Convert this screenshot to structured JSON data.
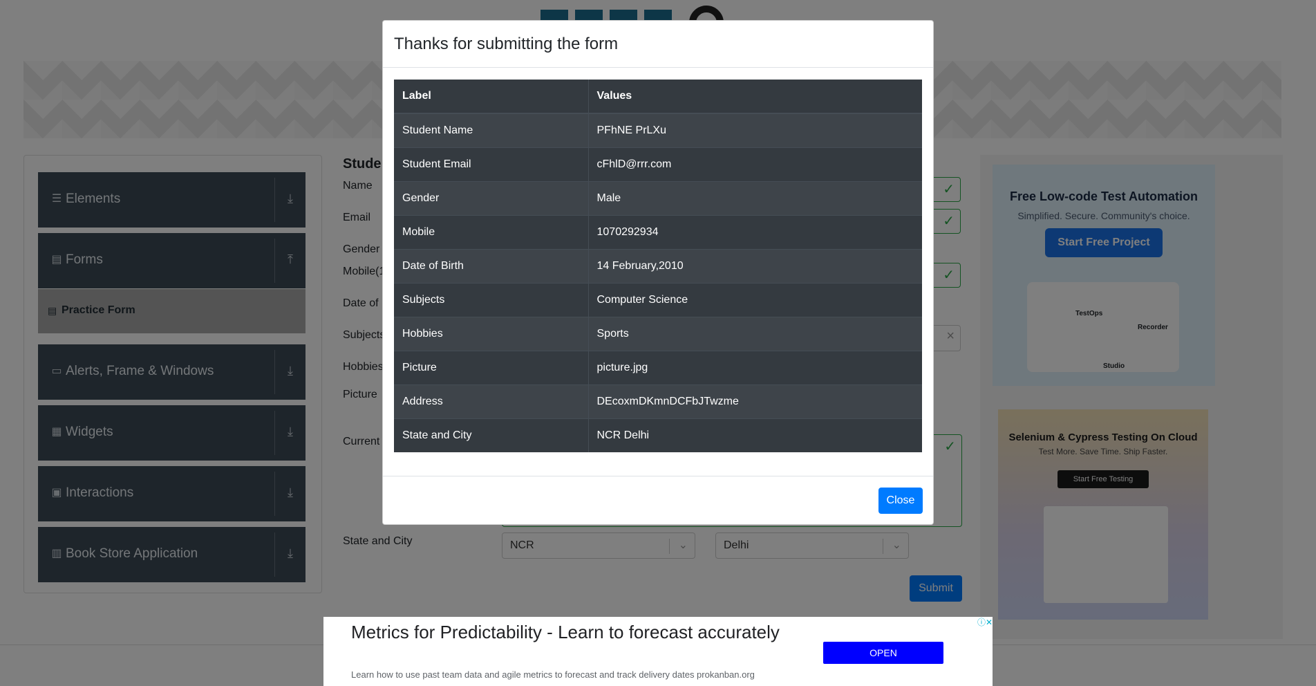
{
  "header": {
    "logo_alt": "ToolsQA"
  },
  "sidebar": {
    "groups": [
      {
        "label": "Elements",
        "icon": "hamburger-icon",
        "arrow": "download-arrow-icon"
      },
      {
        "label": "Forms",
        "icon": "document-icon",
        "arrow": "upload-arrow-icon"
      },
      {
        "label": "Alerts, Frame & Windows",
        "icon": "window-icon",
        "arrow": "download-arrow-icon"
      },
      {
        "label": "Widgets",
        "icon": "widgets-icon",
        "arrow": "download-arrow-icon"
      },
      {
        "label": "Interactions",
        "icon": "interactions-icon",
        "arrow": "download-arrow-icon"
      },
      {
        "label": "Book Store Application",
        "icon": "books-icon",
        "arrow": "download-arrow-icon"
      }
    ],
    "active_item": "Practice Form"
  },
  "form": {
    "title": "Student Registration Form",
    "labels": {
      "name": "Name",
      "email": "Email",
      "gender": "Gender",
      "mobile": "Mobile(10 Digits)",
      "dob": "Date of Birth",
      "subjects": "Subjects",
      "hobbies": "Hobbies",
      "picture": "Picture",
      "address": "Current Address",
      "state_city": "State and City"
    },
    "state_value": "NCR",
    "city_value": "Delhi",
    "submit_label": "Submit"
  },
  "ads": {
    "ad1": {
      "title": "Free Low-code Test Automation",
      "subtitle": "Simplified. Secure. Community's choice.",
      "button": "Start Free Project",
      "labels": [
        "TestOps",
        "Recorder",
        "Studio"
      ]
    },
    "ad2": {
      "title": "Selenium & Cypress Testing On Cloud",
      "subtitle": "Test More. Save Time. Ship Faster.",
      "button": "Start Free Testing"
    },
    "bottom": {
      "headline": "Metrics for Predictability - Learn to forecast accurately",
      "description": "Learn how to use past team data and agile metrics to forecast and track delivery dates prokanban.org",
      "button": "OPEN"
    }
  },
  "modal": {
    "title": "Thanks for submitting the form",
    "table": {
      "headers": [
        "Label",
        "Values"
      ],
      "rows": [
        [
          "Student Name",
          "PFhNE PrLXu"
        ],
        [
          "Student Email",
          "cFhlD@rrr.com"
        ],
        [
          "Gender",
          "Male"
        ],
        [
          "Mobile",
          "1070292934"
        ],
        [
          "Date of Birth",
          "14 February,2010"
        ],
        [
          "Subjects",
          "Computer Science"
        ],
        [
          "Hobbies",
          "Sports"
        ],
        [
          "Picture",
          "picture.jpg"
        ],
        [
          "Address",
          "DEcoxmDKmnDCFbJTwzme"
        ],
        [
          "State and City",
          "NCR Delhi"
        ]
      ]
    },
    "close_label": "Close"
  }
}
